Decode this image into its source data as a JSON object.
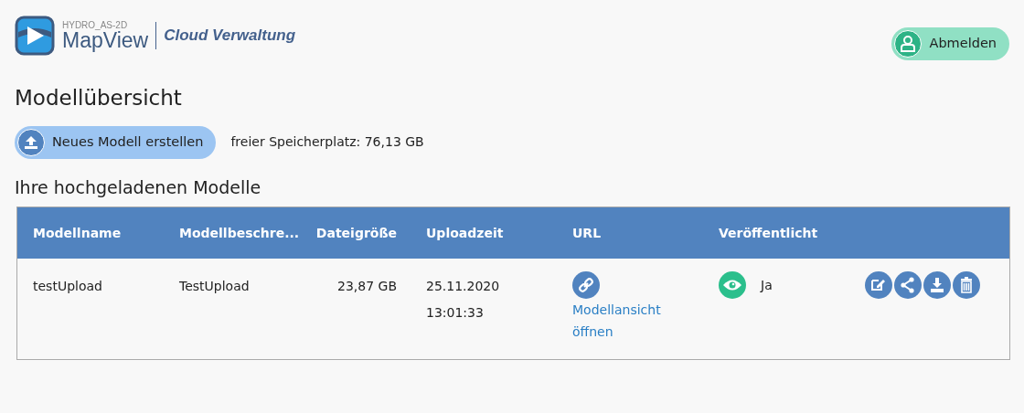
{
  "header": {
    "logo_top": "HYDRO_AS-2D",
    "logo_name": "MapView",
    "subtitle": "Cloud Verwaltung",
    "logout_button": "Abmelden"
  },
  "page_title": "Modellübersicht",
  "toolbar": {
    "new_model_button": "Neues Modell erstellen",
    "storage": "freier Speicherplatz: 76,13 GB"
  },
  "section_title": "Ihre hochgeladenen Modelle",
  "table": {
    "columns": [
      "Modellname",
      "Modellbeschre...",
      "Dateigröße",
      "Uploadzeit",
      "URL",
      "Veröffentlicht"
    ],
    "rows": [
      {
        "name": "testUpload",
        "description": "TestUpload",
        "size": "23,87 GB",
        "upload_date": "25.11.2020",
        "upload_time": "13:01:33",
        "url_link": "Modellansicht öffnen",
        "published": true,
        "published_label": "Ja"
      }
    ]
  }
}
